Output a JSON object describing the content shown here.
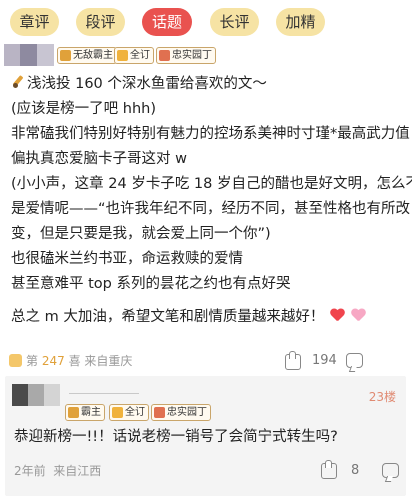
{
  "tabs": [
    {
      "label": "章评",
      "active": false
    },
    {
      "label": "段评",
      "active": false
    },
    {
      "label": "话题",
      "active": true
    },
    {
      "label": "长评",
      "active": false
    },
    {
      "label": "加精",
      "active": false
    }
  ],
  "post": {
    "medals": [
      "无敌霸主",
      "全订",
      "忠实园丁"
    ],
    "lines": [
      "浅浅投 160 个深水鱼雷给喜欢的文～",
      "(应该是榜一了吧 hhh)",
      "非常磕我们特别好特别有魅力的控场系美神时寸瑾*最高武力值",
      "偏执真恋爱脑卡子哥这对 w",
      "(小小声，这章 24 岁卡子吃 18 岁自己的醋也是好文明，怎么不",
      "是爱情呢——“也许我年纪不同，经历不同，甚至性格也有所改",
      "变，但是只要是我，就会爱上同一个你”)",
      "也很磕米兰约书亚，命运救赎的爱情",
      "甚至意难平 top 系列的昙花之约也有点好哭",
      "总之 m 大加油，希望文笔和剧情质量越来越好！"
    ],
    "floor_prefix": "第",
    "floor_number": "247",
    "floor_suffix": "喜",
    "location": "来自重庆",
    "likes": "194"
  },
  "reply": {
    "floor": "23楼",
    "medals": [
      "霸主",
      "全订",
      "忠实园丁"
    ],
    "text": "恭迎新榜一!!！话说老榜一销号了会简宁式转生吗?",
    "time": "2年前",
    "location": "来自江西",
    "likes": "8"
  },
  "colors": {
    "tab_bg": "#f6e3a4",
    "tab_active": "#e9524f",
    "floor_highlight": "#e0a13a",
    "reply_floor": "#e08a72"
  },
  "icons": {
    "post_lead": "pen-icon",
    "hearts": [
      "red-heart-icon",
      "pink-heart-icon"
    ],
    "like": "thumb-up-icon",
    "comment": "comment-icon"
  }
}
